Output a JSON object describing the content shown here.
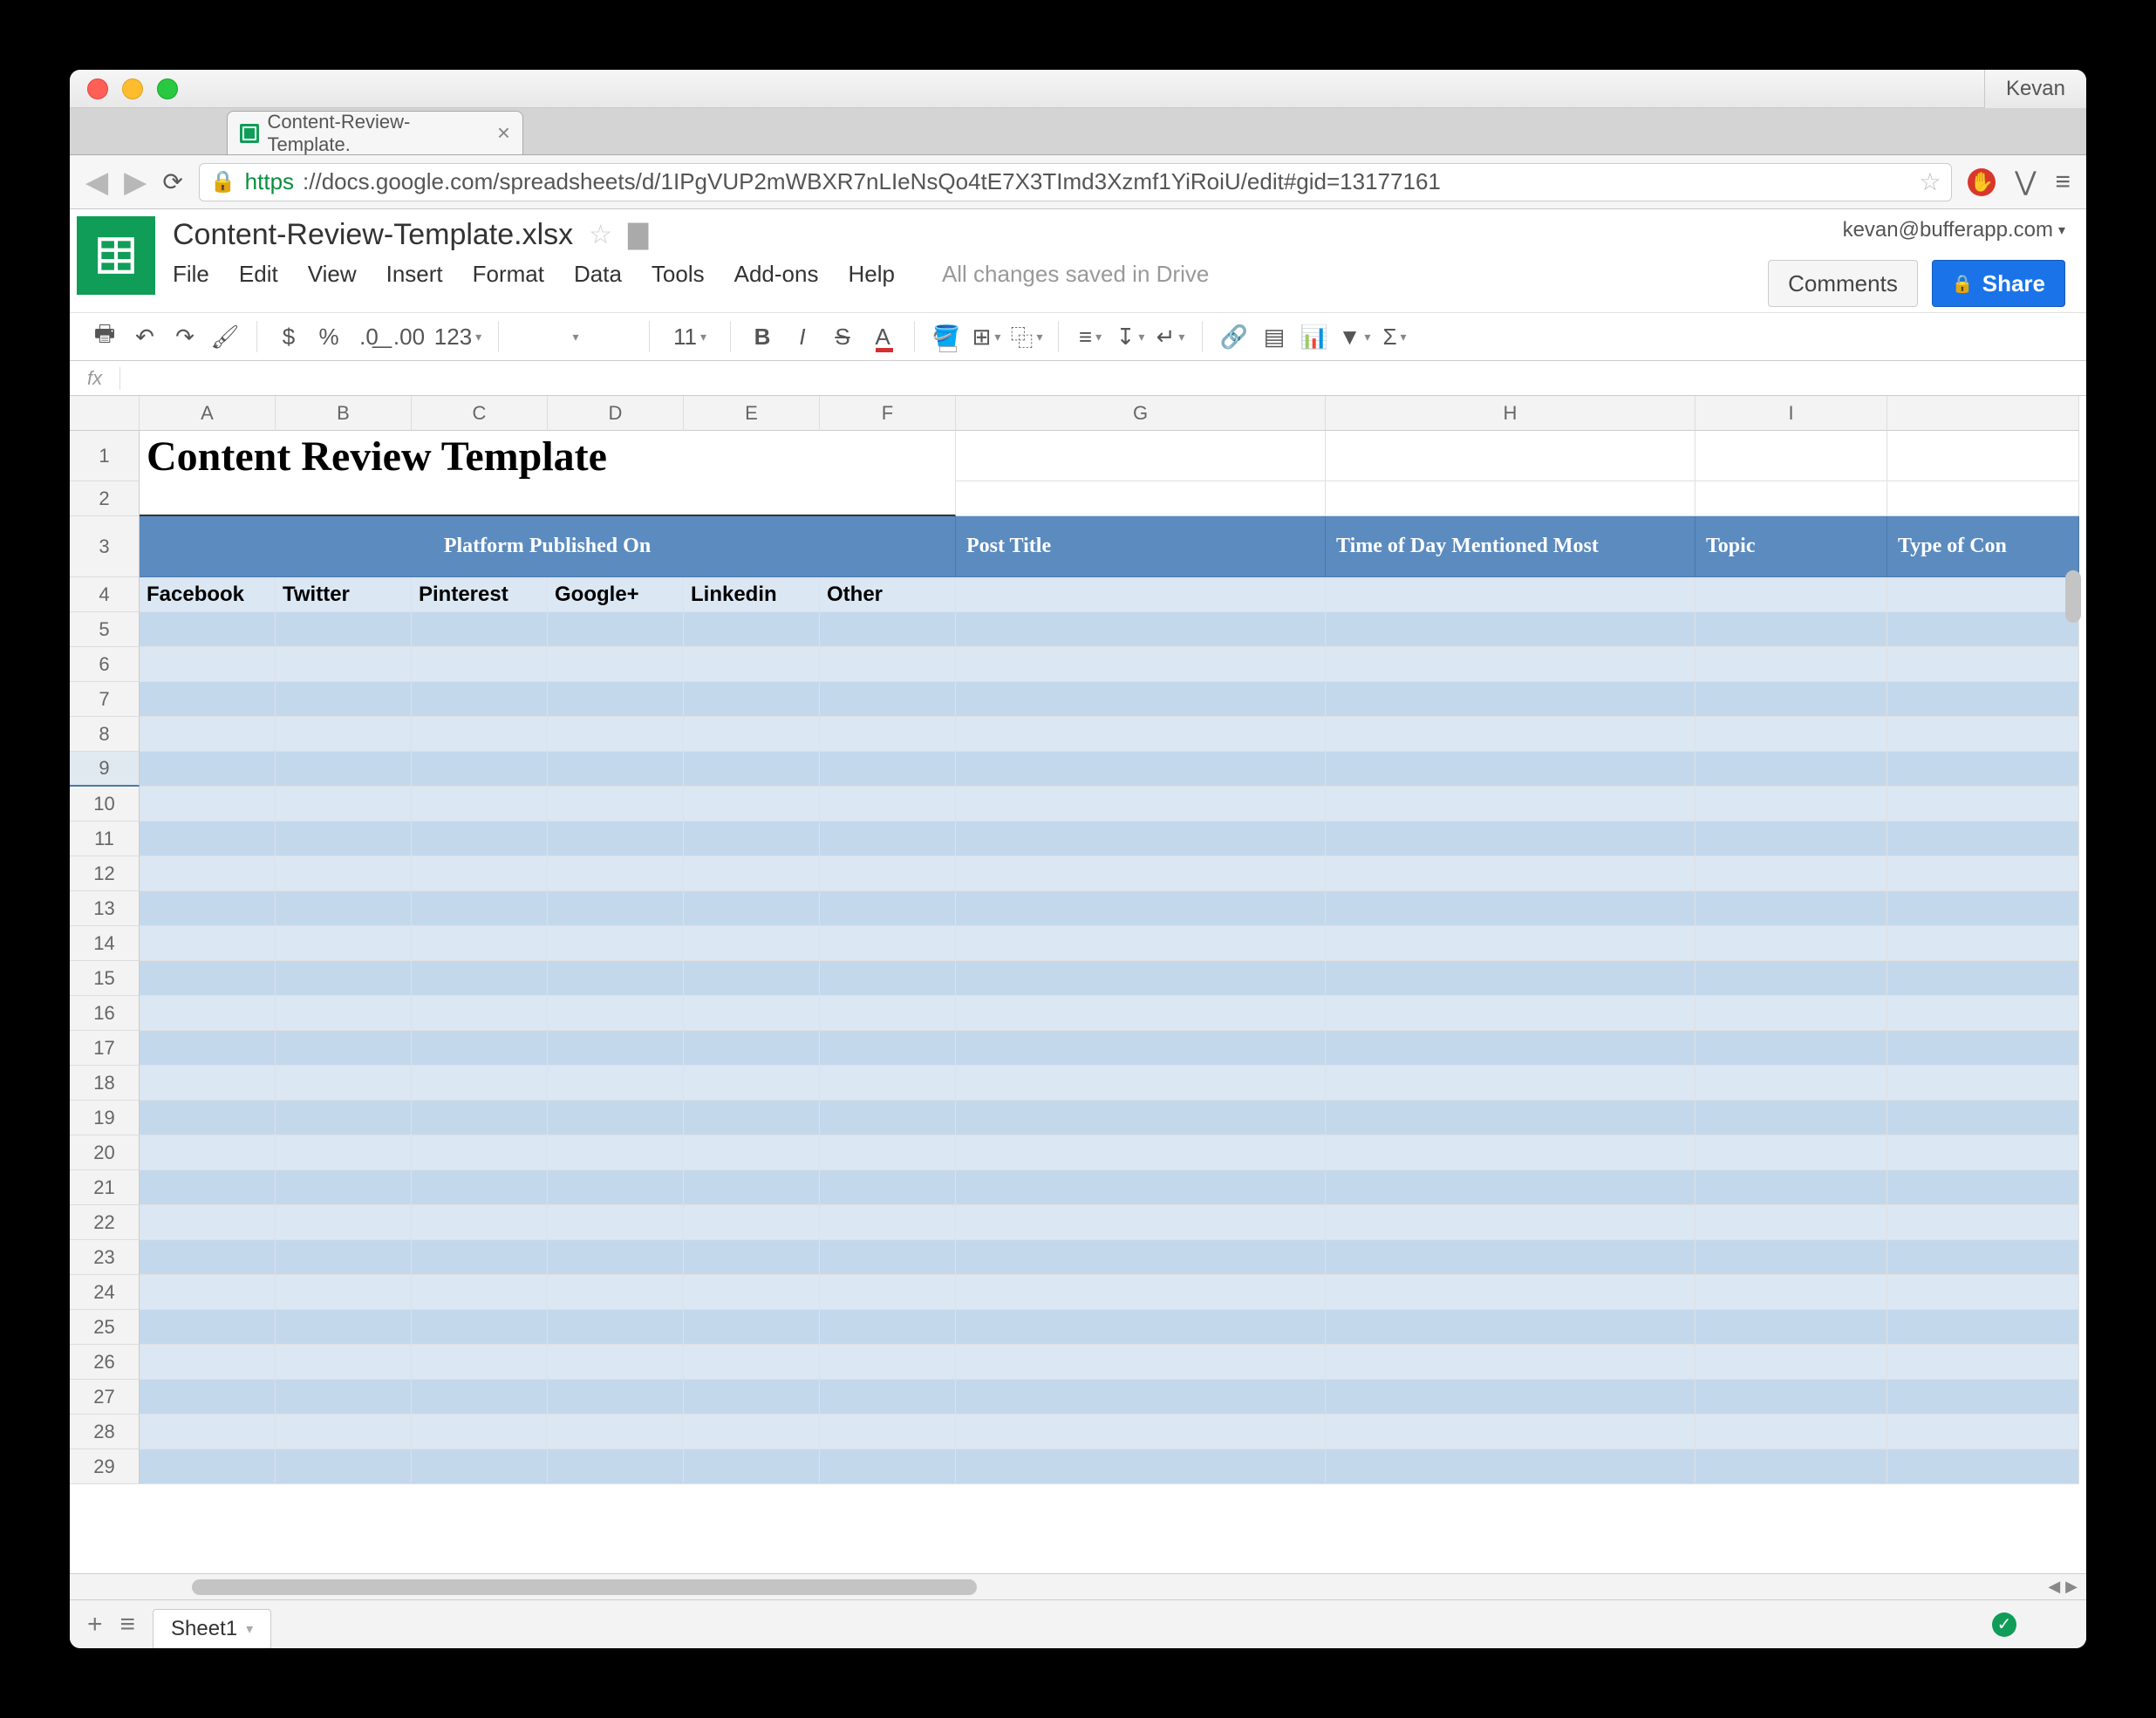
{
  "mac": {
    "user": "Kevan"
  },
  "browser": {
    "tab_title": "Content-Review-Template.",
    "url_scheme": "https",
    "url_rest": "://docs.google.com/spreadsheets/d/1IPgVUP2mWBXR7nLIeNsQo4tE7X3TImd3Xzmf1YiRoiU/edit#gid=13177161"
  },
  "sheets": {
    "doc_title": "Content-Review-Template.xlsx",
    "account": "kevan@bufferapp.com",
    "menus": [
      "File",
      "Edit",
      "View",
      "Insert",
      "Format",
      "Data",
      "Tools",
      "Add-ons",
      "Help"
    ],
    "save_status": "All changes saved in Drive",
    "comments_btn": "Comments",
    "share_btn": "Share",
    "font_size": "11",
    "number_fmt": "123",
    "sheet_tab": "Sheet1",
    "fx_label": "fx"
  },
  "grid": {
    "columns": [
      "A",
      "B",
      "C",
      "D",
      "E",
      "F",
      "G",
      "H",
      "I"
    ],
    "row_numbers": [
      1,
      2,
      3,
      4,
      5,
      6,
      7,
      8,
      9,
      10,
      11,
      12,
      13,
      14,
      15,
      16,
      17,
      18,
      19,
      20,
      21,
      22,
      23,
      24,
      25,
      26,
      27,
      28,
      29
    ],
    "title": "Content Review Template",
    "header_row": {
      "platform_merged": "Platform Published On",
      "post_title": "Post Title",
      "time_of_day": "Time of Day Mentioned Most",
      "topic": "Topic",
      "type_of_content": "Type of Con"
    },
    "subheaders": [
      "Facebook",
      "Twitter",
      "Pinterest",
      "Google+",
      "Linkedin",
      "Other"
    ]
  }
}
